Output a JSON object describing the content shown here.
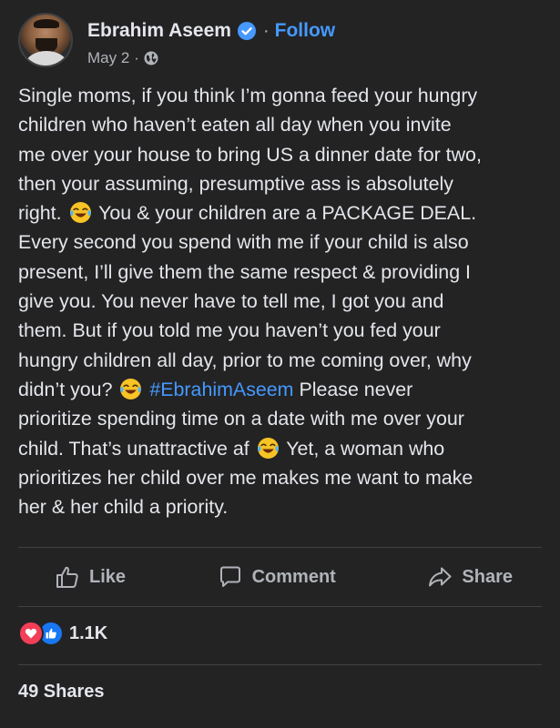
{
  "post": {
    "author": "Ebrahim Aseem",
    "follow_label": "Follow",
    "date": "May 2",
    "separator": "·",
    "lines": [
      "Single moms, if you think I’m gonna feed your hungry",
      "children who haven’t eaten all day when you invite",
      "me over your house to bring US a dinner date for two,",
      "then your assuming, presumptive ass is absolutely"
    ],
    "line5_a": "right.",
    "line5_b": "You & your children are a PACKAGE DEAL.",
    "lines2": [
      "Every second you spend with me if your child is also",
      "present, I’ll give them the same respect & providing I",
      "give you. You never have to tell me, I got you and",
      "them. But if you told me you haven’t you fed your",
      "hungry children all day, prior to me coming over, why"
    ],
    "line11_a": "didn’t you?",
    "hashtag": "#EbrahimAseem",
    "line11_b": "Please never",
    "line12": "prioritize spending time on a date with me over your",
    "line13_a": "child. That’s unattractive af",
    "line13_b": "Yet, a woman who",
    "line14": "prioritizes her child over me makes me want to make",
    "line15": "her & her child a priority."
  },
  "actions": {
    "like": "Like",
    "comment": "Comment",
    "share": "Share"
  },
  "stats": {
    "reactions_count": "1.1K",
    "shares": "49 Shares"
  },
  "icons": {
    "verified": "verified-badge-icon",
    "globe": "globe-icon",
    "emoji": "laughing-tears-emoji-icon",
    "like": "thumbs-up-icon",
    "comment": "comment-bubble-icon",
    "share": "share-arrow-icon",
    "love_reaction": "heart-reaction-icon",
    "like_reaction": "like-reaction-icon"
  },
  "colors": {
    "background": "#232324",
    "text": "#e4e6eb",
    "secondary_text": "#b0b3b8",
    "link": "#4599ff",
    "love": "#f33e58",
    "like": "#1877f2"
  }
}
